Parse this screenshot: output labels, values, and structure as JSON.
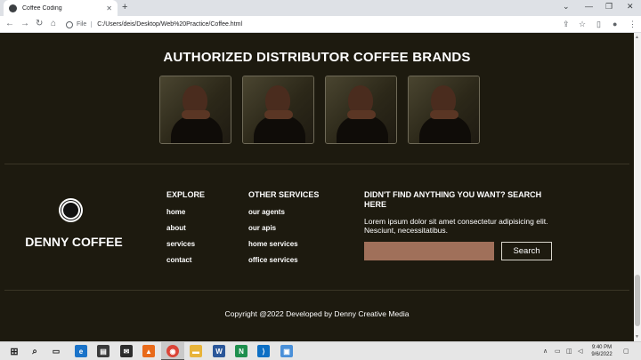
{
  "browser": {
    "tab_title": "Coffee Coding",
    "file_label": "File",
    "url": "C:/Users/deis/Desktop/Web%20Practice/Coffee.html"
  },
  "page": {
    "brands_title": "AUTHORIZED DISTRIBUTOR COFFEE BRANDS",
    "brands": [
      {
        "alt": "brand-1"
      },
      {
        "alt": "brand-2"
      },
      {
        "alt": "brand-3"
      },
      {
        "alt": "brand-4"
      }
    ],
    "footer": {
      "brand_name": "DENNY COFFEE",
      "explore": {
        "title": "EXPLORE",
        "links": [
          "home",
          "about",
          "services",
          "contact"
        ]
      },
      "other_services": {
        "title": "OTHER SERVICES",
        "links": [
          "our agents",
          "our apis",
          "home services",
          "office services"
        ]
      },
      "cta": {
        "title_line1": "DIDN'T FIND ANYTHING YOU WANT? SEARCH",
        "title_line2": "HERE",
        "text": "Lorem ipsum dolor sit amet consectetur adipisicing elit. Nesciunt, necessitatibus.",
        "input_placeholder": "",
        "button_label": "Search"
      },
      "copyright": "Copyright @2022 Developed by Denny Creative Media"
    }
  },
  "taskbar": {
    "time": "9:40 PM",
    "date": "9/6/2022"
  },
  "colors": {
    "page_bg": "#1d1a0f",
    "input_bg": "#a0705a"
  }
}
